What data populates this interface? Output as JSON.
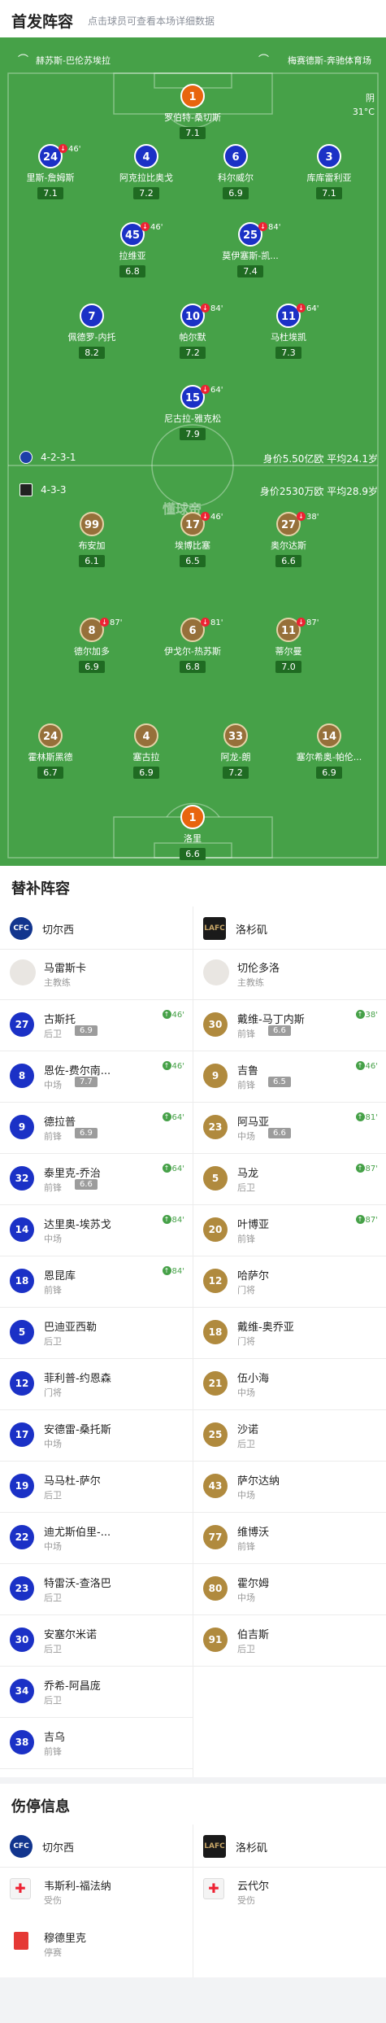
{
  "header": {
    "title": "首发阵容",
    "subtitle": "点击球员可查看本场详细数据"
  },
  "venue": {
    "home": "赫苏斯-巴伦苏埃拉",
    "away": "梅赛德斯-奔驰体育场"
  },
  "weather": {
    "condition": "阴",
    "temp": "31°C"
  },
  "watermark": "懂球帝",
  "home_formation": {
    "formation": "4-2-3-1",
    "value": "身价5.50亿欧",
    "age": "平均24.1岁"
  },
  "away_formation": {
    "formation": "4-3-3",
    "value": "身价2530万欧",
    "age": "平均28.9岁"
  },
  "home_players": [
    {
      "num": "1",
      "name": "罗伯特-桑切斯",
      "rating": "7.1"
    },
    {
      "num": "24",
      "name": "里斯-詹姆斯",
      "rating": "7.1",
      "event": "46'"
    },
    {
      "num": "4",
      "name": "阿克拉比奥戈",
      "rating": "7.2"
    },
    {
      "num": "6",
      "name": "科尔威尔",
      "rating": "6.9"
    },
    {
      "num": "3",
      "name": "库库雷利亚",
      "rating": "7.1"
    },
    {
      "num": "45",
      "name": "拉维亚",
      "rating": "6.8",
      "event": "46'"
    },
    {
      "num": "25",
      "name": "莫伊塞斯-凯...",
      "rating": "7.4",
      "event": "84'"
    },
    {
      "num": "7",
      "name": "佩德罗-内托",
      "rating": "8.2"
    },
    {
      "num": "10",
      "name": "帕尔默",
      "rating": "7.2",
      "event": "84'"
    },
    {
      "num": "11",
      "name": "马杜埃凯",
      "rating": "7.3",
      "event": "64'"
    },
    {
      "num": "15",
      "name": "尼古拉-雅克松",
      "rating": "7.9",
      "event": "64'"
    }
  ],
  "away_players": [
    {
      "num": "99",
      "name": "布安加",
      "rating": "6.1"
    },
    {
      "num": "17",
      "name": "埃博比塞",
      "rating": "6.5",
      "event": "46'"
    },
    {
      "num": "27",
      "name": "奥尔达斯",
      "rating": "6.6",
      "event": "38'"
    },
    {
      "num": "8",
      "name": "德尔加多",
      "rating": "6.9",
      "event": "87'"
    },
    {
      "num": "6",
      "name": "伊戈尔-热苏斯",
      "rating": "6.8",
      "event": "81'"
    },
    {
      "num": "11",
      "name": "蒂尔曼",
      "rating": "7.0",
      "event": "87'"
    },
    {
      "num": "24",
      "name": "霍林斯黑德",
      "rating": "6.7"
    },
    {
      "num": "4",
      "name": "塞古拉",
      "rating": "6.9"
    },
    {
      "num": "33",
      "name": "阿龙-朗",
      "rating": "7.2"
    },
    {
      "num": "14",
      "name": "塞尔希奥-帕伦...",
      "rating": "6.9"
    },
    {
      "num": "1",
      "name": "洛里",
      "rating": "6.6"
    }
  ],
  "subs_title": "替补阵容",
  "home_team": "切尔西",
  "away_team": "洛杉矶",
  "home_logo": "CFC",
  "away_logo": "LAFC",
  "home_subs": [
    {
      "name": "马雷斯卡",
      "pos": "主教练",
      "coach": true
    },
    {
      "num": "27",
      "name": "古斯托",
      "pos": "后卫",
      "rating": "6.9",
      "time": "46'"
    },
    {
      "num": "8",
      "name": "恩佐-费尔南...",
      "pos": "中场",
      "rating": "7.7",
      "time": "46'"
    },
    {
      "num": "9",
      "name": "德拉普",
      "pos": "前锋",
      "rating": "6.9",
      "time": "64'"
    },
    {
      "num": "32",
      "name": "泰里克-乔治",
      "pos": "前锋",
      "rating": "6.6",
      "time": "64'"
    },
    {
      "num": "14",
      "name": "达里奥-埃苏戈",
      "pos": "中场",
      "time": "84'"
    },
    {
      "num": "18",
      "name": "恩昆库",
      "pos": "前锋",
      "time": "84'"
    },
    {
      "num": "5",
      "name": "巴迪亚西勒",
      "pos": "后卫"
    },
    {
      "num": "12",
      "name": "菲利普-约恩森",
      "pos": "门将"
    },
    {
      "num": "17",
      "name": "安德雷-桑托斯",
      "pos": "中场"
    },
    {
      "num": "19",
      "name": "马马杜-萨尔",
      "pos": "后卫"
    },
    {
      "num": "22",
      "name": "迪尤斯伯里-...",
      "pos": "中场"
    },
    {
      "num": "23",
      "name": "特雷沃-查洛巴",
      "pos": "后卫"
    },
    {
      "num": "30",
      "name": "安塞尔米诺",
      "pos": "后卫"
    },
    {
      "num": "34",
      "name": "乔希-阿昌庞",
      "pos": "后卫"
    },
    {
      "num": "38",
      "name": "吉乌",
      "pos": "前锋"
    }
  ],
  "away_subs": [
    {
      "name": "切伦多洛",
      "pos": "主教练",
      "coach": true
    },
    {
      "num": "30",
      "name": "戴维-马丁内斯",
      "pos": "前锋",
      "rating": "6.6",
      "time": "38'"
    },
    {
      "num": "9",
      "name": "吉鲁",
      "pos": "前锋",
      "rating": "6.5",
      "time": "46'"
    },
    {
      "num": "23",
      "name": "阿马亚",
      "pos": "中场",
      "rating": "6.6",
      "time": "81'"
    },
    {
      "num": "5",
      "name": "马龙",
      "pos": "后卫",
      "time": "87'"
    },
    {
      "num": "20",
      "name": "叶博亚",
      "pos": "前锋",
      "time": "87'"
    },
    {
      "num": "12",
      "name": "哈萨尔",
      "pos": "门将"
    },
    {
      "num": "18",
      "name": "戴维-奥乔亚",
      "pos": "门将"
    },
    {
      "num": "21",
      "name": "伍小海",
      "pos": "中场"
    },
    {
      "num": "25",
      "name": "沙诺",
      "pos": "后卫"
    },
    {
      "num": "43",
      "name": "萨尔达纳",
      "pos": "中场"
    },
    {
      "num": "77",
      "name": "维博沃",
      "pos": "前锋"
    },
    {
      "num": "80",
      "name": "霍尔姆",
      "pos": "中场"
    },
    {
      "num": "91",
      "name": "伯吉斯",
      "pos": "后卫"
    }
  ],
  "injury_title": "伤停信息",
  "home_injuries": [
    {
      "name": "韦斯利-福法纳",
      "status": "受伤",
      "type": "injury"
    },
    {
      "name": "穆德里克",
      "status": "停赛",
      "type": "red"
    }
  ],
  "away_injuries": [
    {
      "name": "云代尔",
      "status": "受伤",
      "type": "injury"
    }
  ]
}
